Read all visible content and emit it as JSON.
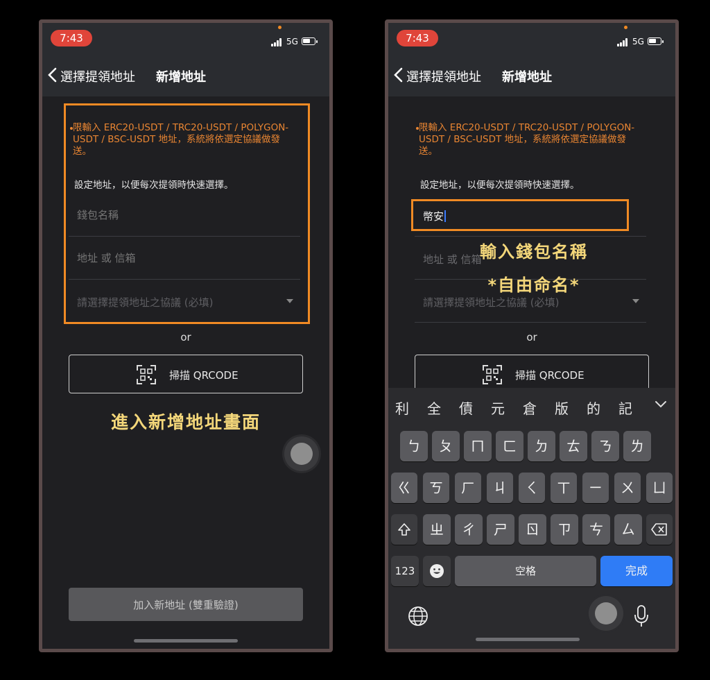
{
  "left": {
    "status": {
      "time": "7:43",
      "network": "5G"
    },
    "nav": {
      "back_label": "選擇提領地址",
      "title": "新增地址"
    },
    "notice": "限輸入 ERC20-USDT / TRC20-USDT / POLYGON-USDT / BSC-USDT 地址，系統將依選定協議做發送。",
    "hint": "設定地址，以便每次提領時快速選擇。",
    "wallet_name_placeholder": "錢包名稱",
    "address_placeholder": "地址 或 信箱",
    "protocol_placeholder": "請選擇提領地址之協議 (必填)",
    "or_label": "or",
    "scan_label": "掃描 QRCODE",
    "annotation": "進入新增地址畫面",
    "add_button": "加入新地址 (雙重驗證)"
  },
  "right": {
    "status": {
      "time": "7:43",
      "network": "5G"
    },
    "nav": {
      "back_label": "選擇提領地址",
      "title": "新增地址"
    },
    "notice": "限輸入 ERC20-USDT / TRC20-USDT / POLYGON-USDT / BSC-USDT 地址，系統將依選定協議做發送。",
    "hint": "設定地址，以便每次提領時快速選擇。",
    "wallet_name_value": "幣安",
    "address_placeholder": "地址 或 信箱",
    "protocol_placeholder": "請選擇提領地址之協議 (必填)",
    "or_label": "or",
    "scan_label": "掃描 QRCODE",
    "annotation_line1": "輸入錢包名稱",
    "annotation_line2": "*自由命名*",
    "keyboard": {
      "candidates": [
        "利",
        "全",
        "債",
        "元",
        "倉",
        "版",
        "的",
        "記"
      ],
      "row1": [
        "ㄅ",
        "ㄆ",
        "ㄇ",
        "ㄈ",
        "ㄉ",
        "ㄊ",
        "ㄋ",
        "ㄌ"
      ],
      "row2": [
        "ㄍ",
        "ㄎ",
        "ㄏ",
        "ㄐ",
        "ㄑ",
        "ㄒ",
        "ㄧ",
        "ㄨ",
        "ㄩ"
      ],
      "row3": [
        "ㄓ",
        "ㄔ",
        "ㄕ",
        "ㄖ",
        "ㄗ",
        "ㄘ",
        "ㄙ"
      ],
      "numbers_key": "123",
      "space_key": "空格",
      "done_key": "完成"
    }
  },
  "colors": {
    "accent_orange": "#f08a24",
    "annotation_yellow": "#f4d77a",
    "done_blue": "#2f7cf6",
    "time_pill": "#e0453a"
  },
  "icons": [
    "chevron-left-icon",
    "qr-scan-icon",
    "signal-icon",
    "battery-icon",
    "chevron-down-icon",
    "shift-icon",
    "backspace-icon",
    "emoji-icon",
    "globe-icon",
    "microphone-icon"
  ]
}
